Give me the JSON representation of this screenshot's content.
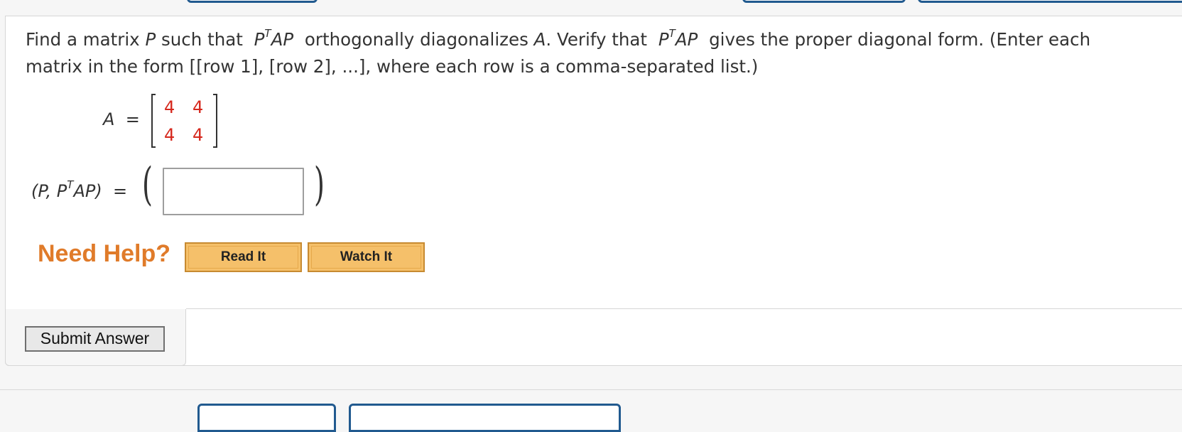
{
  "question": {
    "line1": {
      "t1": "Find a matrix ",
      "P": "P",
      "t2": " such that ",
      "P2": "P",
      "T": "T",
      "AP": "AP",
      "t3": " orthogonally diagonalizes ",
      "A": "A",
      "t4": ". Verify that ",
      "P3": "P",
      "T2": "T",
      "AP2": "AP",
      "t5": " gives the proper diagonal form. (Enter each"
    },
    "line2": "matrix in the form [[row 1], [row 2], ...], where each row is a comma-separated list.)"
  },
  "matrix": {
    "label": "A",
    "equals": "=",
    "rows": [
      [
        "4",
        "4"
      ],
      [
        "4",
        "4"
      ]
    ],
    "value_color": "#d6281d"
  },
  "answer": {
    "label_open": "(P, P",
    "label_sup": "T",
    "label_close": "AP)",
    "equals": "=",
    "value": ""
  },
  "help": {
    "title": "Need Help?",
    "read_it": "Read It",
    "watch_it": "Watch It",
    "title_color": "#e07b2a"
  },
  "submit": {
    "label": "Submit Answer"
  }
}
